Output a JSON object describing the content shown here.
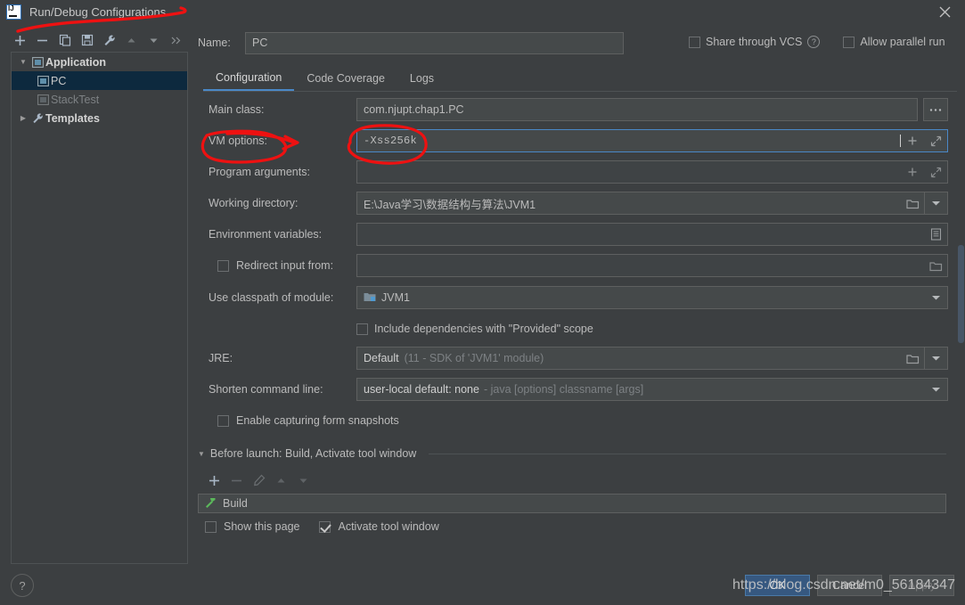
{
  "window": {
    "title": "Run/Debug Configurations",
    "logo_icon": "intellij-idea-logo-icon",
    "close_icon": "close-icon"
  },
  "left_panel": {
    "toolbar": [
      {
        "name": "add-configuration-button",
        "icon": "plus-icon",
        "label": "+"
      },
      {
        "name": "remove-configuration-button",
        "icon": "minus-icon",
        "label": "−"
      },
      {
        "name": "copy-configuration-button",
        "icon": "copy-icon",
        "label": "copy"
      },
      {
        "name": "save-configuration-button",
        "icon": "save-icon",
        "label": "save"
      },
      {
        "name": "edit-templates-button",
        "icon": "wrench-icon",
        "label": "wrench"
      },
      {
        "name": "move-up-button",
        "icon": "arrow-up-icon",
        "label": "up"
      },
      {
        "name": "move-down-button",
        "icon": "arrow-down-icon",
        "label": "down"
      },
      {
        "name": "more-options-button",
        "icon": "chevron-double-right-icon",
        "label": "»"
      }
    ],
    "tree": [
      {
        "label": "Application",
        "icon": "application-folder-icon",
        "expanded": true,
        "selected": false,
        "dim": false,
        "bold": true,
        "indent": false
      },
      {
        "label": "PC",
        "icon": "run-configuration-icon",
        "expanded": null,
        "selected": true,
        "dim": false,
        "bold": false,
        "indent": true
      },
      {
        "label": "StackTest",
        "icon": "run-configuration-icon",
        "expanded": null,
        "selected": false,
        "dim": true,
        "bold": false,
        "indent": true
      },
      {
        "label": "Templates",
        "icon": "wrench-icon",
        "expanded": false,
        "selected": false,
        "dim": false,
        "bold": true,
        "indent": false
      }
    ]
  },
  "help_button": {
    "label": "?",
    "icon": "help-icon"
  },
  "header": {
    "name_label": "Name:",
    "name_value": "PC",
    "share_vcs_label": "Share through VCS",
    "share_vcs_checked": false,
    "help_icon": "question-mark-icon",
    "allow_parallel_label": "Allow parallel run",
    "allow_parallel_checked": false
  },
  "tabs": [
    {
      "label": "Configuration",
      "active": true
    },
    {
      "label": "Code Coverage",
      "active": false
    },
    {
      "label": "Logs",
      "active": false
    }
  ],
  "form": {
    "main_class": {
      "label": "Main class:",
      "value": "com.njupt.chap1.PC",
      "browse_icon": "ellipsis-icon",
      "browse_label": "..."
    },
    "vm_options": {
      "label": "VM options:",
      "value": "-Xss256k",
      "focused": true,
      "macro_icon": "plus-icon",
      "expand_icon": "expand-diagonal-icon"
    },
    "program_arguments": {
      "label": "Program arguments:",
      "value": "",
      "macro_icon": "plus-icon",
      "expand_icon": "expand-diagonal-icon"
    },
    "working_directory": {
      "label": "Working directory:",
      "value": "E:\\Java学习\\数据结构与算法\\JVM1",
      "browse_icon": "folder-open-icon",
      "dropdown_icon": "chevron-down-icon"
    },
    "environment_variables": {
      "label": "Environment variables:",
      "value": "",
      "browse_icon": "list-edit-icon"
    },
    "redirect_input": {
      "label": "Redirect input from:",
      "checked": false,
      "value": "",
      "browse_icon": "folder-open-icon"
    },
    "use_classpath": {
      "label": "Use classpath of module:",
      "value": "JVM1",
      "module_icon": "module-icon",
      "dropdown_icon": "chevron-down-icon"
    },
    "include_provided": {
      "label": "Include dependencies with \"Provided\" scope",
      "checked": false
    },
    "jre": {
      "label": "JRE:",
      "value": "Default",
      "hint": "(11 - SDK of 'JVM1' module)",
      "browse_icon": "folder-open-icon",
      "dropdown_icon": "chevron-down-icon"
    },
    "shorten_command_line": {
      "label": "Shorten command line:",
      "value": "user-local default: none",
      "hint": "- java [options] classname [args]",
      "dropdown_icon": "chevron-down-icon"
    },
    "enable_snapshots": {
      "label": "Enable capturing form snapshots",
      "checked": false
    }
  },
  "before_launch": {
    "title": "Before launch: Build, Activate tool window",
    "expanded": true,
    "toolbar": [
      {
        "name": "add-task-button",
        "icon": "plus-icon",
        "label": "+",
        "disabled": false
      },
      {
        "name": "remove-task-button",
        "icon": "minus-icon",
        "label": "−",
        "disabled": true
      },
      {
        "name": "edit-task-button",
        "icon": "pencil-icon",
        "label": "edit",
        "disabled": true
      },
      {
        "name": "task-move-up-button",
        "icon": "arrow-up-icon",
        "label": "up",
        "disabled": true
      },
      {
        "name": "task-move-down-button",
        "icon": "arrow-down-icon",
        "label": "down",
        "disabled": true
      }
    ],
    "tasks": [
      {
        "label": "Build",
        "icon": "build-hammer-icon"
      }
    ],
    "show_this_page": {
      "label": "Show this page",
      "checked": false
    },
    "activate_tool_window": {
      "label": "Activate tool window",
      "checked": true
    }
  },
  "footer": {
    "buttons": [
      {
        "label": "OK",
        "name": "ok-button",
        "primary": true,
        "disabled": false
      },
      {
        "label": "Cancel",
        "name": "cancel-button",
        "primary": false,
        "disabled": false
      },
      {
        "label": "Apply",
        "name": "apply-button",
        "primary": false,
        "disabled": true
      }
    ]
  },
  "watermark": {
    "text": "https://blog.csdn.net/m0_56184347"
  },
  "annotations": {
    "color": "#ee1111",
    "marks": [
      {
        "name": "title-underline-scribble",
        "desc": "red squiggle under window title"
      },
      {
        "name": "vm-options-label-circle",
        "desc": "red ellipse with arrow around VM options label"
      },
      {
        "name": "vm-options-value-circle",
        "desc": "red ellipse around -Xss256k value"
      }
    ]
  },
  "colors": {
    "window_bg": "#3c3f41",
    "field_bg": "#45494a",
    "border": "#5e6060",
    "accent": "#4a88c7",
    "selection": "#0d293e",
    "primary_button": "#365880",
    "annotation_red": "#ee1111",
    "text": "#bbbbbb",
    "text_dim": "#7d8184"
  }
}
